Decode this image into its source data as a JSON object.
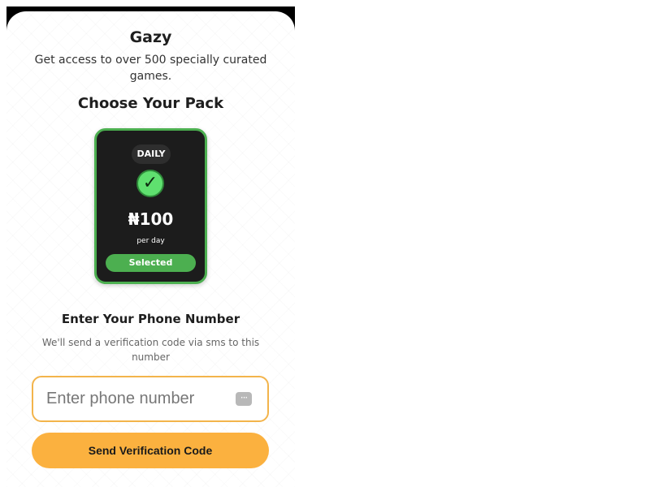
{
  "app": {
    "title": "Gazy",
    "subtitle": "Get access to over 500 specially curated games."
  },
  "packs": {
    "heading": "Choose Your Pack",
    "selected_pack": {
      "tag": "DAILY",
      "check_icon": "checkmark-icon",
      "check_glyph": "✓",
      "price": "₦100",
      "period": "per day",
      "status": "Selected"
    }
  },
  "phone": {
    "heading": "Enter Your Phone Number",
    "description": "We'll send a verification code via sms to this number",
    "input": {
      "value": "",
      "placeholder": "Enter phone number"
    },
    "keypad_icon": "keypad-icon",
    "keypad_glyph": "···"
  },
  "actions": {
    "send_button": "Send Verification Code"
  },
  "colors": {
    "accent": "#FBB13F",
    "selected_green": "#4CAF50",
    "card_background": "#1C1C1C"
  }
}
